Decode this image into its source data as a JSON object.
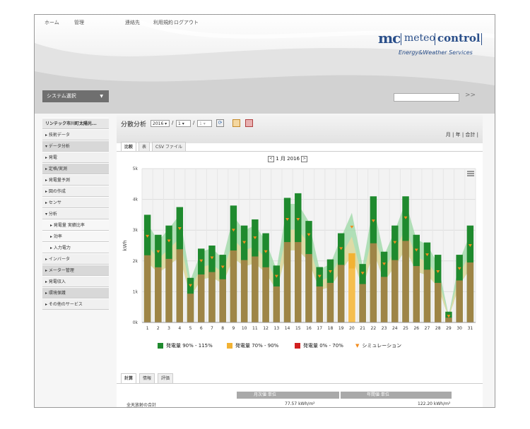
{
  "nav": {
    "home": "ホーム",
    "admin": "管理",
    "contact": "連絡先",
    "terms": "利用規約",
    "logout": "ログアウト"
  },
  "logo": {
    "mark": "mc",
    "word1": "meteo",
    "word2": "control",
    "tagline": "Energy&Weather Services"
  },
  "system_select": {
    "label": "システム選択",
    "caret": "▼"
  },
  "search": {
    "placeholder": "",
    "go": ">>"
  },
  "sidebar": {
    "items": [
      {
        "label": "リンテック市川町太陽光..."
      },
      {
        "label": "▸ 技術データ"
      },
      {
        "label": "▾ データ分析"
      },
      {
        "label": "▸ 発電"
      },
      {
        "label": "▸ 定格/実測"
      },
      {
        "label": "▸ 発電量予測"
      },
      {
        "label": "▸ 図の作成"
      },
      {
        "label": "▸ センサ"
      },
      {
        "label": "▾ 分析"
      },
      {
        "label": "▸ 発電量 実績比率"
      },
      {
        "label": "▸ 効率"
      },
      {
        "label": "▸ 入力電力"
      },
      {
        "label": "▸ インバータ"
      },
      {
        "label": "▸ メーター管理"
      },
      {
        "label": "▸ 発電収入"
      },
      {
        "label": "▸ 環境保護"
      },
      {
        "label": "▸ その他のサービス"
      }
    ]
  },
  "content": {
    "title": "分散分析",
    "year": "2016 ▾",
    "month": "1 ▾",
    "day": "1 ▾",
    "sep": "/",
    "range_links": "月 | 年 | 合計 |",
    "tabs": [
      "比較",
      "表",
      "CSV ファイル"
    ],
    "month_nav": {
      "prev": "<",
      "label": "1 月 2016",
      "next": ">"
    },
    "bottom_tabs": [
      "計算",
      "情報",
      "評価"
    ],
    "table": {
      "col1_header": "月次値 単位",
      "col2_header": "年間値 単位",
      "row_label": "全天放射の合計",
      "row_month": "77.57 kWh/m²",
      "row_year": "122.20 kWh/m²"
    }
  },
  "chart_data": {
    "type": "bar",
    "ylabel": "kWh",
    "ylim": [
      0,
      5
    ],
    "yticks": [
      "0k",
      "1k",
      "2k",
      "3k",
      "4k",
      "5k"
    ],
    "categories": [
      "1",
      "2",
      "3",
      "4",
      "5",
      "6",
      "7",
      "8",
      "9",
      "10",
      "11",
      "12",
      "13",
      "14",
      "15",
      "16",
      "17",
      "18",
      "19",
      "20",
      "21",
      "22",
      "23",
      "24",
      "25",
      "26",
      "27",
      "28",
      "29",
      "30",
      "31"
    ],
    "series": [
      {
        "name": "発電量 90% - 115%",
        "color": "#1f8a2e",
        "values": [
          3.5,
          2.85,
          3.15,
          3.75,
          1.45,
          2.4,
          2.5,
          2.2,
          3.8,
          3.15,
          3.35,
          2.9,
          1.85,
          4.05,
          4.2,
          3.3,
          1.8,
          2.05,
          2.9,
          2.25,
          1.9,
          4.1,
          2.3,
          3.15,
          4.1,
          2.85,
          2.6,
          2.2,
          0.35,
          2.2,
          3.15
        ]
      },
      {
        "name": "発電量 70% - 90%",
        "color": "#f2b233",
        "values": []
      },
      {
        "name": "発電量 0% - 70%",
        "color": "#d11f1f",
        "values": []
      },
      {
        "name": "シミュレーション",
        "color": "#f28c1e",
        "values": [
          2.8,
          2.3,
          2.65,
          3.05,
          1.2,
          2.0,
          2.1,
          1.8,
          3.0,
          2.6,
          2.75,
          2.3,
          1.5,
          3.35,
          3.35,
          2.85,
          1.5,
          1.65,
          2.4,
          3.1,
          1.6,
          3.3,
          1.9,
          2.6,
          3.4,
          2.35,
          2.2,
          1.65,
          0.2,
          1.75,
          2.5
        ]
      }
    ],
    "highlight_index": 19,
    "highlight_value": 2.25,
    "grid": true
  },
  "legend": {
    "green": "発電量 90% - 115%",
    "yellow": "発電量 70% - 90%",
    "red": "発電量 0% - 70%",
    "sim": "シミュレーション",
    "sim_marker": "▼"
  },
  "colors": {
    "green": "#1f8a2e",
    "yellow": "#f2b233",
    "red": "#d11f1f",
    "orange": "#f28c1e",
    "band": "#9fd9a8"
  }
}
